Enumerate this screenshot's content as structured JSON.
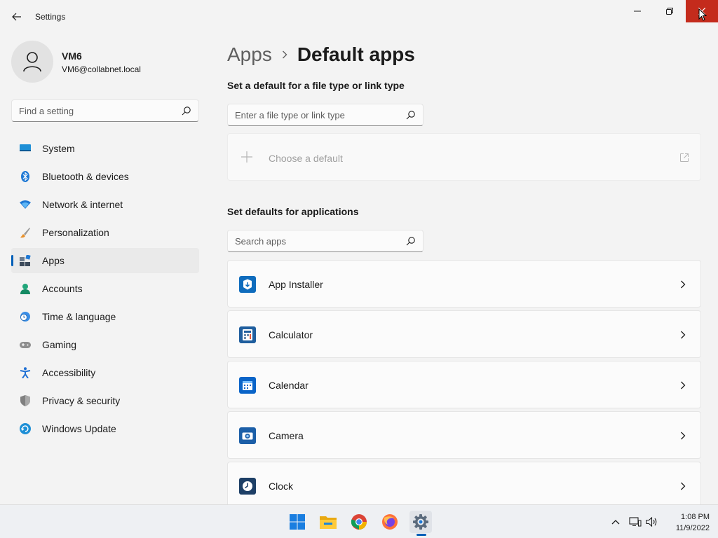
{
  "window": {
    "title": "Settings"
  },
  "profile": {
    "name": "VM6",
    "email": "VM6@collabnet.local"
  },
  "search": {
    "placeholder": "Find a setting"
  },
  "nav": {
    "items": [
      {
        "label": "System",
        "icon": "system-icon"
      },
      {
        "label": "Bluetooth & devices",
        "icon": "bluetooth-icon"
      },
      {
        "label": "Network & internet",
        "icon": "wifi-icon"
      },
      {
        "label": "Personalization",
        "icon": "brush-icon"
      },
      {
        "label": "Apps",
        "icon": "apps-icon",
        "active": true
      },
      {
        "label": "Accounts",
        "icon": "accounts-icon"
      },
      {
        "label": "Time & language",
        "icon": "clock-globe-icon"
      },
      {
        "label": "Gaming",
        "icon": "gamepad-icon"
      },
      {
        "label": "Accessibility",
        "icon": "accessibility-icon"
      },
      {
        "label": "Privacy & security",
        "icon": "shield-icon"
      },
      {
        "label": "Windows Update",
        "icon": "update-icon"
      }
    ]
  },
  "breadcrumb": {
    "parent": "Apps",
    "current": "Default apps"
  },
  "filetype": {
    "heading": "Set a default for a file type or link type",
    "placeholder": "Enter a file type or link type",
    "choose_label": "Choose a default"
  },
  "applications": {
    "heading": "Set defaults for applications",
    "search_placeholder": "Search apps",
    "list": [
      {
        "name": "App Installer",
        "icon": "app-installer-icon"
      },
      {
        "name": "Calculator",
        "icon": "calculator-icon"
      },
      {
        "name": "Calendar",
        "icon": "calendar-icon"
      },
      {
        "name": "Camera",
        "icon": "camera-icon"
      },
      {
        "name": "Clock",
        "icon": "clock-icon"
      }
    ]
  },
  "taskbar": {
    "apps": [
      "start-icon",
      "file-explorer-icon",
      "chrome-icon",
      "firefox-icon",
      "settings-icon"
    ],
    "time": "1:08 PM",
    "date": "11/9/2022"
  },
  "colors": {
    "accent": "#005fb8",
    "close_hover": "#c42b1c",
    "background": "#f3f3f3"
  }
}
